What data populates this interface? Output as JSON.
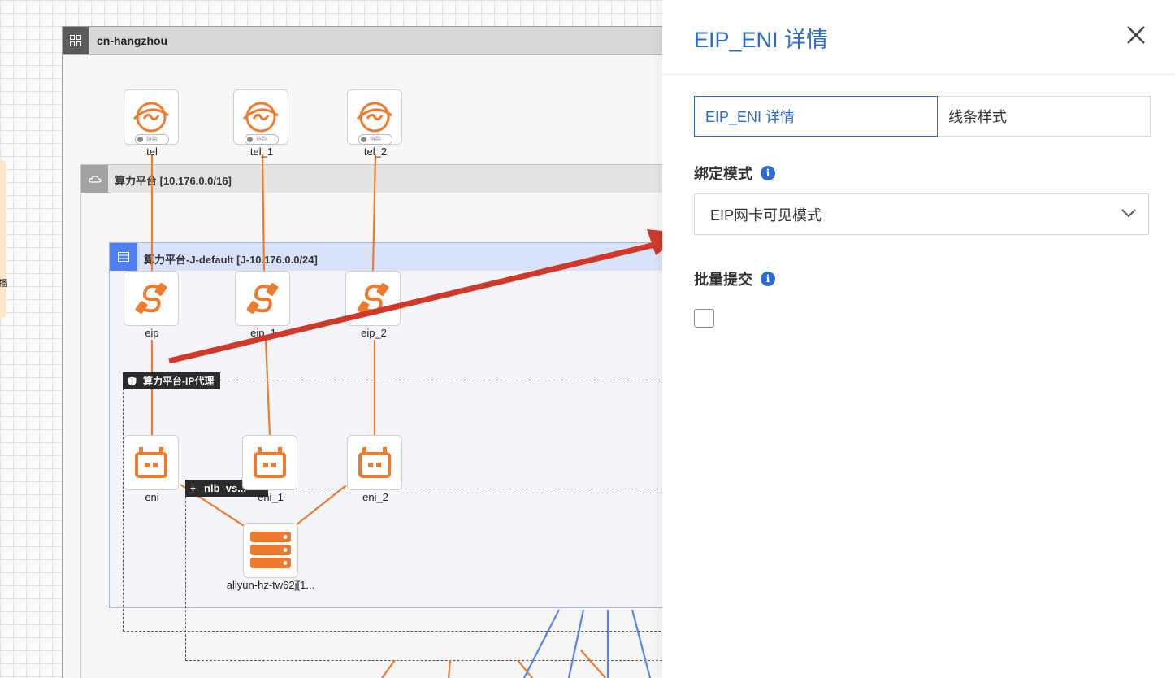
{
  "topology": {
    "region": {
      "name": "cn-hangzhou"
    },
    "vpc": {
      "name": "算力平台 [10.176.0.0/16]"
    },
    "vswitch": {
      "name": "算力平台-J-default [J-10.176.0.0/24]"
    },
    "security_group": {
      "name": "算力平台-IP代理"
    },
    "nlb": {
      "name": "nlb_vs..."
    },
    "nodes": {
      "tel": "tel",
      "tel_1": "tel_1",
      "tel_2": "tel_2",
      "eip": "eip",
      "eip_1": "eip_1",
      "eip_2": "eip_2",
      "eni": "eni",
      "eni_1": "eni_1",
      "eni_2": "eni_2",
      "ecs": "aliyun-hz-tw62j[1..."
    },
    "badge_text": "链路",
    "side_tab_label": "播",
    "colors": {
      "link": "#ee7a2e",
      "extra_link": "#5a82ea",
      "arrow": "#d0382a"
    }
  },
  "panel": {
    "title": "EIP_ENI 详情",
    "tabs": [
      {
        "label": "EIP_ENI 详情",
        "active": true
      },
      {
        "label": "线条样式",
        "active": false
      }
    ],
    "binding_mode": {
      "label": "绑定模式",
      "value": "EIP网卡可见模式"
    },
    "batch_submit": {
      "label": "批量提交",
      "checked": false
    },
    "accent": "#2a6bd2"
  }
}
